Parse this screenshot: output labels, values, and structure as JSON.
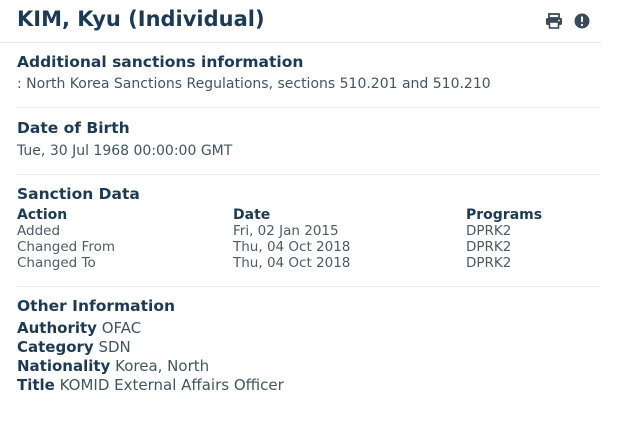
{
  "header": {
    "title": "KIM, Kyu (Individual)",
    "print_icon": "print-icon",
    "alert_icon": "alert-icon"
  },
  "additional": {
    "title": "Additional sanctions information",
    "text": ": North Korea Sanctions Regulations, sections 510.201 and 510.210"
  },
  "dob": {
    "title": "Date of Birth",
    "value": "Tue, 30 Jul 1968 00:00:00 GMT"
  },
  "sanction": {
    "title": "Sanction Data",
    "headers": {
      "action": "Action",
      "date": "Date",
      "programs": "Programs"
    },
    "rows": [
      {
        "action": "Added",
        "date": "Fri, 02 Jan 2015",
        "program": "DPRK2"
      },
      {
        "action": "Changed From",
        "date": "Thu, 04 Oct 2018",
        "program": "DPRK2"
      },
      {
        "action": "Changed To",
        "date": "Thu, 04 Oct 2018",
        "program": "DPRK2"
      }
    ]
  },
  "other": {
    "title": "Other Information",
    "items": [
      {
        "key": "Authority",
        "value": "OFAC"
      },
      {
        "key": "Category",
        "value": "SDN"
      },
      {
        "key": "Nationality",
        "value": "Korea, North"
      },
      {
        "key": "Title",
        "value": "KOMID External Affairs Officer"
      }
    ]
  },
  "colors": {
    "heading": "#1d3a55",
    "text": "#425463",
    "rule": "#e3e6e9"
  }
}
